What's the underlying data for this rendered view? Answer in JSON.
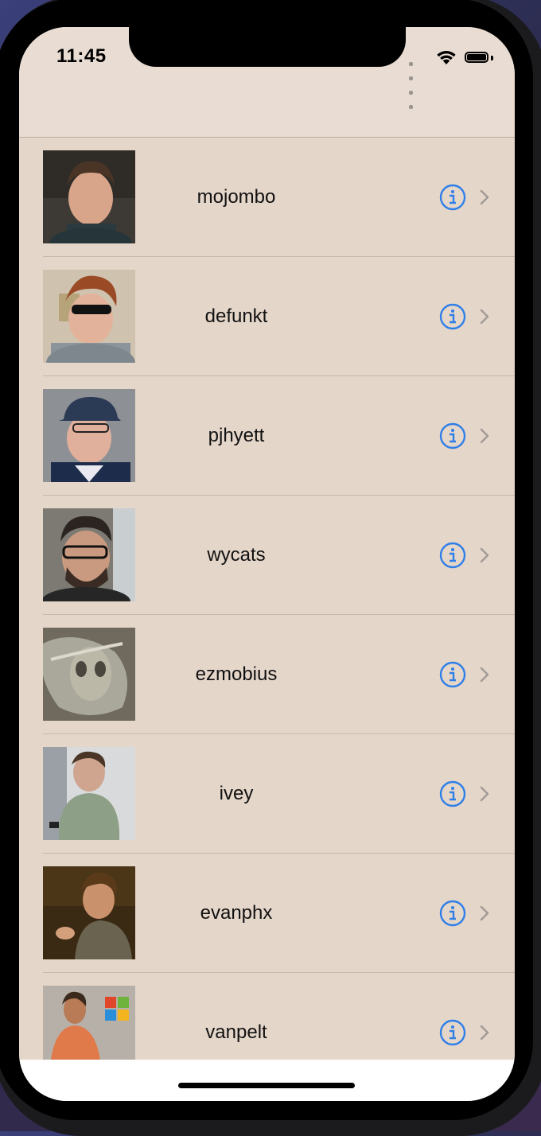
{
  "status_bar": {
    "time": "11:45"
  },
  "users": [
    {
      "login": "mojombo",
      "avatar": "avatar-mojombo"
    },
    {
      "login": "defunkt",
      "avatar": "avatar-defunkt"
    },
    {
      "login": "pjhyett",
      "avatar": "avatar-pjhyett"
    },
    {
      "login": "wycats",
      "avatar": "avatar-wycats"
    },
    {
      "login": "ezmobius",
      "avatar": "avatar-ezmobius"
    },
    {
      "login": "ivey",
      "avatar": "avatar-ivey"
    },
    {
      "login": "evanphx",
      "avatar": "avatar-evanphx"
    },
    {
      "login": "vanpelt",
      "avatar": "avatar-vanpelt"
    }
  ],
  "colors": {
    "background": "#e5d6ca",
    "accent": "#2f7fe8",
    "chevron": "#a39c97"
  }
}
